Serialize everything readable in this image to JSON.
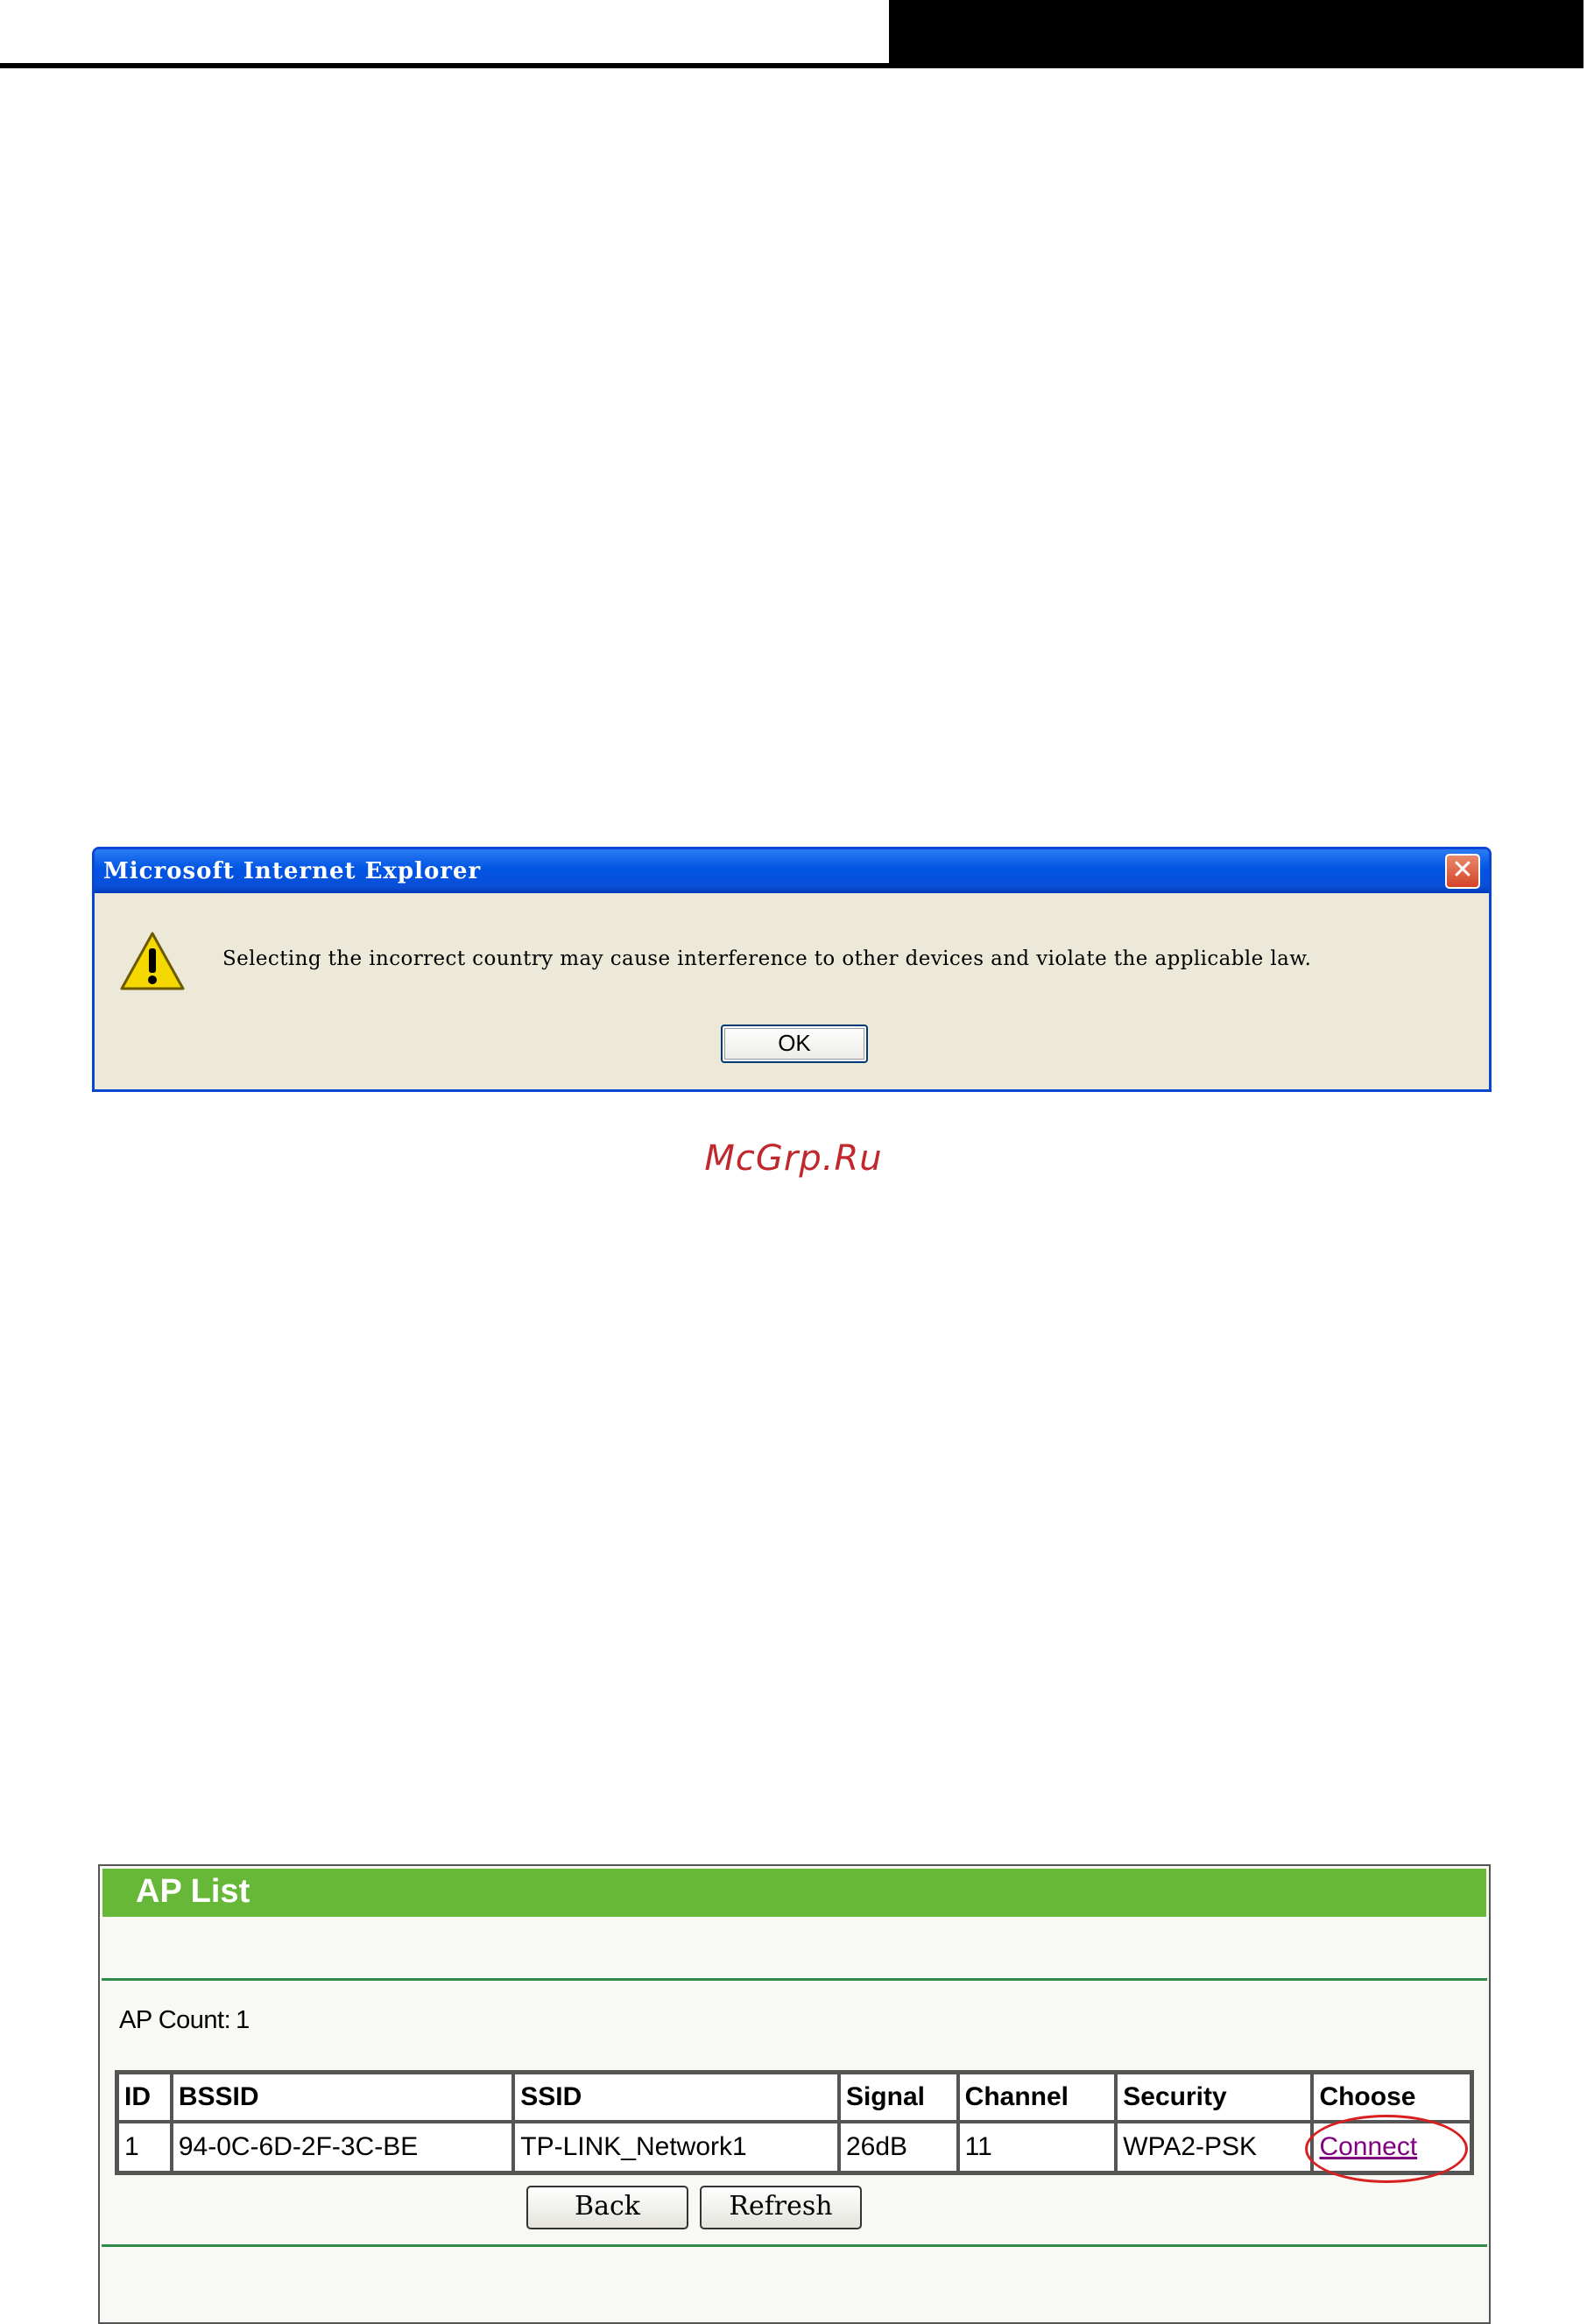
{
  "dialog": {
    "title": "Microsoft Internet Explorer",
    "message": "Selecting the incorrect country may cause interference to other devices and violate the applicable law.",
    "ok_label": "OK",
    "close_glyph": "✕"
  },
  "watermark": "McGrp.Ru",
  "ap_list": {
    "title": "AP List",
    "count_label": "AP Count:",
    "count_value": "1",
    "columns": [
      "ID",
      "BSSID",
      "SSID",
      "Signal",
      "Channel",
      "Security",
      "Choose"
    ],
    "rows": [
      {
        "id": "1",
        "bssid": "94-0C-6D-2F-3C-BE",
        "ssid": "TP-LINK_Network1",
        "signal": "26dB",
        "channel": "11",
        "security": "WPA2-PSK",
        "choose": "Connect"
      }
    ],
    "back_label": "Back",
    "refresh_label": "Refresh"
  },
  "colors": {
    "accent_green": "#67b738",
    "highlight_circle": "#d82020",
    "watermark": "#c0282d"
  }
}
